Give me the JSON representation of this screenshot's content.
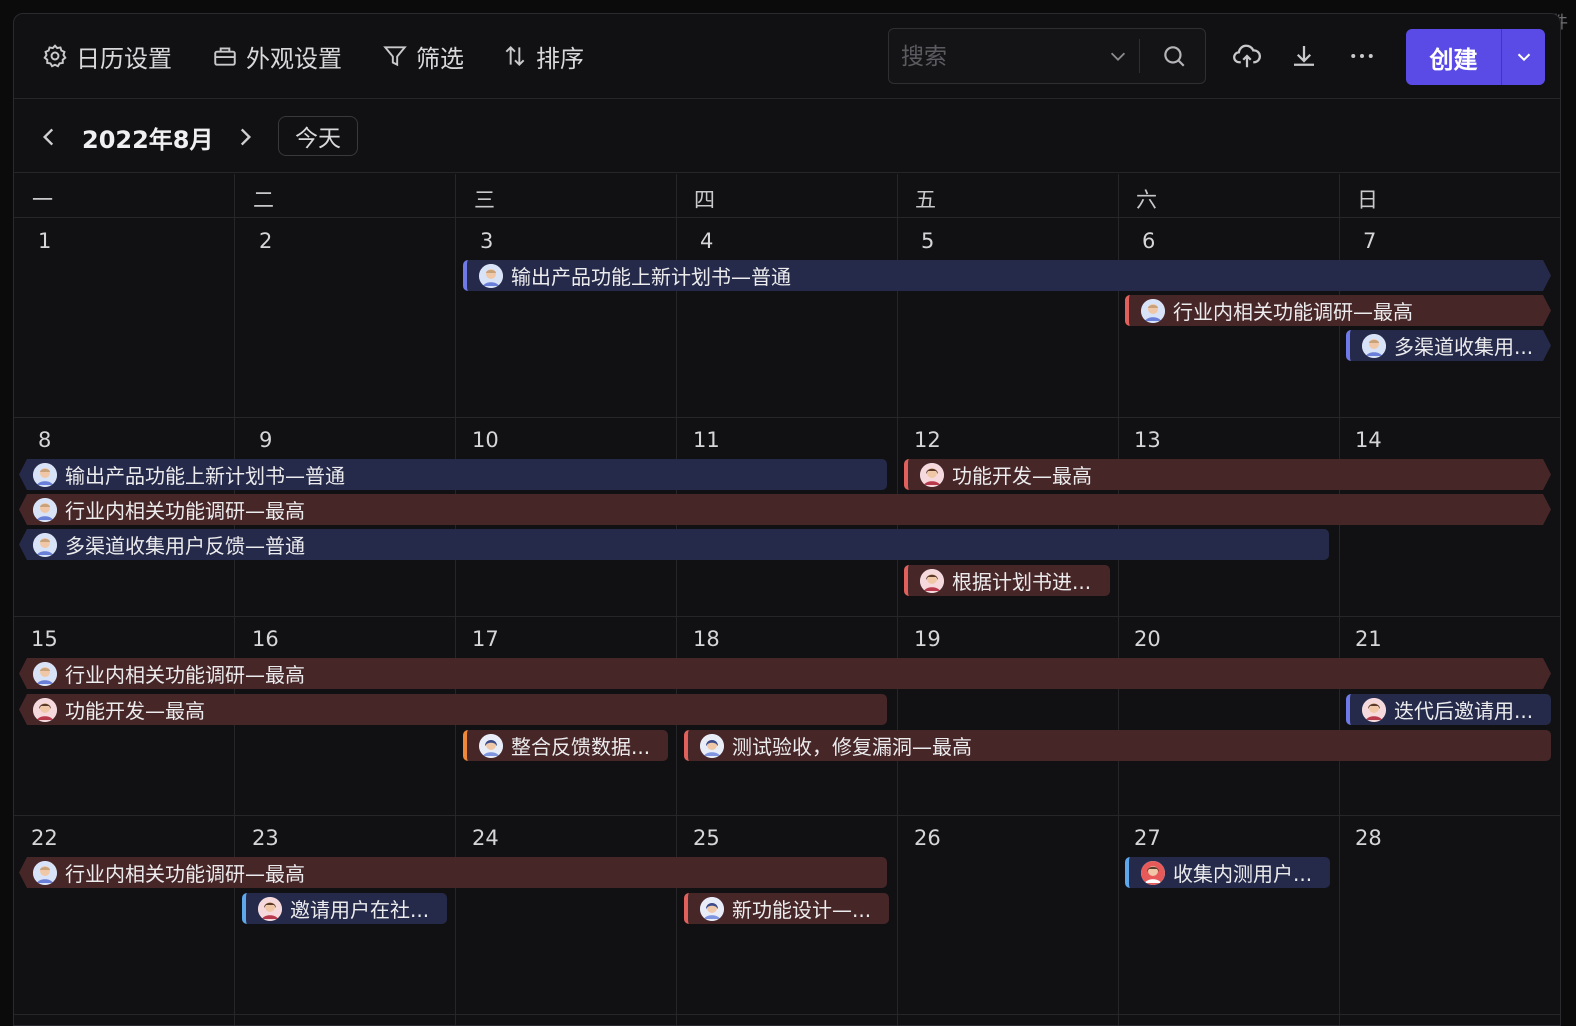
{
  "watermark": "小众软件",
  "toolbar": {
    "calendar_settings": "日历设置",
    "appearance_settings": "外观设置",
    "filter": "筛选",
    "sort": "排序",
    "search_placeholder": "搜索",
    "create": "创建"
  },
  "nav": {
    "month": "2022年8月",
    "today": "今天"
  },
  "weekdays": [
    "一",
    "二",
    "三",
    "四",
    "五",
    "六",
    "日"
  ],
  "weeks": [
    [
      "1",
      "2",
      "3",
      "4",
      "5",
      "6",
      "7"
    ],
    [
      "8",
      "9",
      "10",
      "11",
      "12",
      "13",
      "14"
    ],
    [
      "15",
      "16",
      "17",
      "18",
      "19",
      "20",
      "21"
    ],
    [
      "22",
      "23",
      "24",
      "25",
      "26",
      "27",
      "28"
    ]
  ],
  "events": {
    "w1_a": "输出产品功能上新计划书—普通",
    "w1_b": "行业内相关功能调研—最高",
    "w1_c": "多渠道收集用...",
    "w2_a": "输出产品功能上新计划书—普通",
    "w2_b": "功能开发—最高",
    "w2_c": "行业内相关功能调研—最高",
    "w2_d": "多渠道收集用户反馈—普通",
    "w2_e": "根据计划书进...",
    "w3_a": "行业内相关功能调研—最高",
    "w3_b": "功能开发—最高",
    "w3_c": "迭代后邀请用...",
    "w3_d": "整合反馈数据...",
    "w3_e": "测试验收，修复漏洞—最高",
    "w4_a": "行业内相关功能调研—最高",
    "w4_b": "收集内测用户...",
    "w4_c": "邀请用户在社...",
    "w4_d": "新功能设计—..."
  },
  "colors": {
    "accent": "#5b4be6",
    "event_blue": "#262a4a",
    "event_red": "#472628"
  }
}
